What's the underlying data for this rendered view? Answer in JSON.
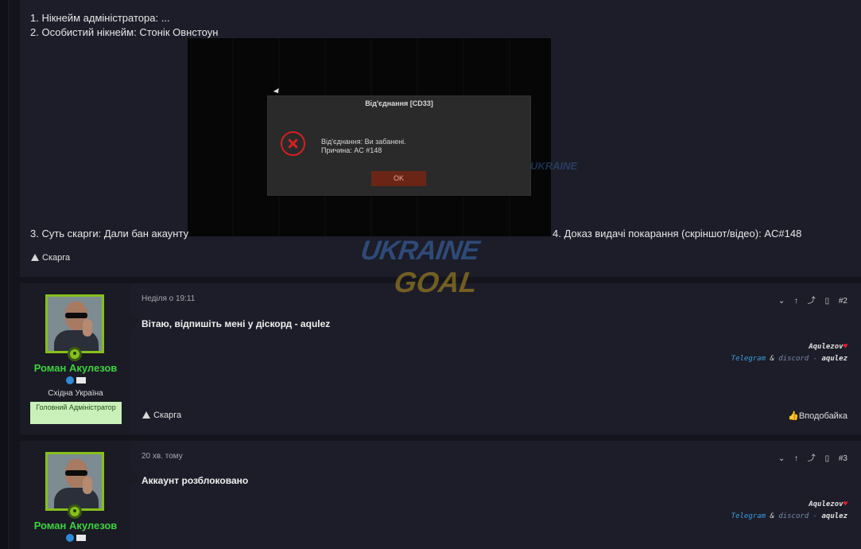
{
  "post1": {
    "line1": "1. Нікнейм адміністратора: ...",
    "line2": "2. Особистий нікнейм: Стонік Овнстоун",
    "line3": "3. Суть скарги: Дали бан акаунту",
    "line4": "4. Доказ видачі покарання (скріншот/відео): AC#148",
    "report_label": "Скарга",
    "embed": {
      "dialog_title": "Від'єднання [CD33]",
      "message_line1": "Від'єднання: Ви забанені.",
      "message_line2": "Причина: AC #148",
      "ok_label": "OK"
    }
  },
  "watermark": {
    "line1": "UKRAINE",
    "line2": "GOAL",
    "small": "UKRAINE"
  },
  "posts": [
    {
      "date": "Неділя о 19:11",
      "number": "#2",
      "body": "Вітаю, відпишіть мені у діскорд - aqulez",
      "user": {
        "name": "Роман Акулезов",
        "location": "Східна Україна",
        "banner": "Головний Адміністратор"
      },
      "signature": {
        "name": "Aqulezov",
        "telegram": "Telegram",
        "amp": "&",
        "discord": "discord",
        "dash": "-",
        "handle": "aqulez"
      },
      "report_label": "Скарга",
      "like_label": "Вподобайка"
    },
    {
      "date": "20 хв. тому",
      "number": "#3",
      "body": "Аккаунт розблоковано",
      "user": {
        "name": "Роман Акулезов"
      },
      "signature": {
        "name": "Aqulezov",
        "telegram": "Telegram",
        "amp": "&",
        "discord": "discord",
        "dash": "-",
        "handle": "aqulez"
      }
    }
  ],
  "icons": {
    "heart": "♥",
    "like": "👍",
    "chevron": "⌄",
    "up": "↑",
    "share": "⤴",
    "bookmark": "🔖"
  },
  "colors": {
    "username": "#3fd13f",
    "avatar_border": "#86c01b",
    "error_red": "#d42020",
    "ok_button": "#6b2517",
    "banner_bg": "#c8f0b8"
  }
}
